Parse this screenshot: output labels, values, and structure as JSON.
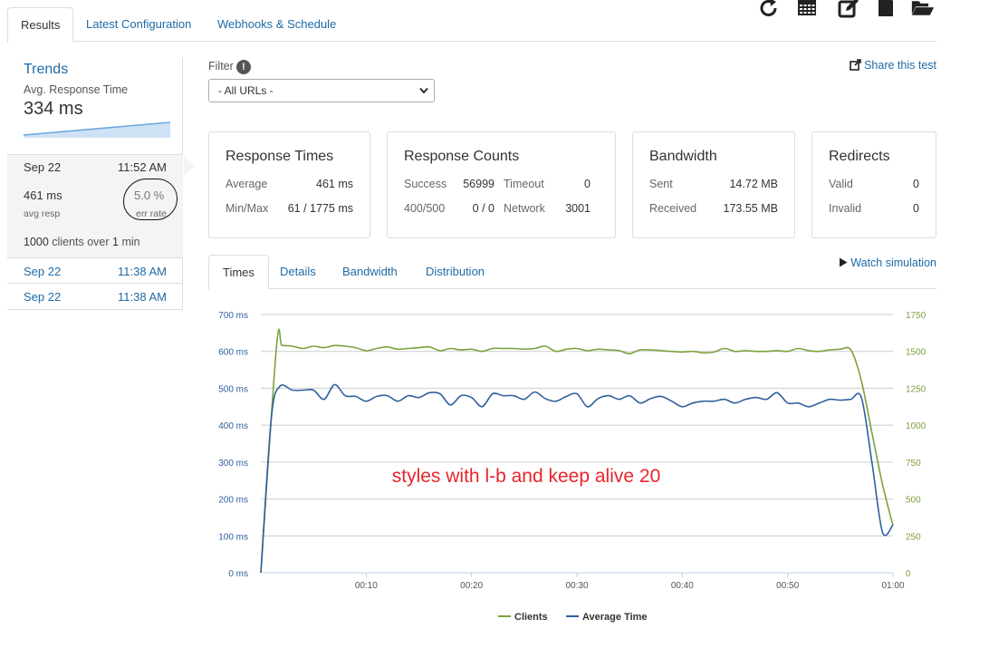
{
  "tabs": [
    {
      "label": "Results",
      "active": true
    },
    {
      "label": "Latest Configuration",
      "active": false
    },
    {
      "label": "Webhooks & Schedule",
      "active": false
    }
  ],
  "toolbar_icons": [
    "refresh-icon",
    "calendar-icon",
    "edit-icon",
    "document-icon",
    "folder-open-icon"
  ],
  "trends": {
    "title": "Trends",
    "metric": "Avg. Response Time",
    "value": "334 ms"
  },
  "runs": {
    "selected": {
      "date": "Sep 22",
      "time": "11:52 AM",
      "avg_resp": "461 ms",
      "avg_resp_label": "avg resp",
      "err_rate": "5.0 %",
      "err_rate_label": "err rate",
      "clients_count": "1000",
      "clients_mid": "clients over",
      "clients_duration": "1",
      "clients_unit": "min"
    },
    "others": [
      {
        "date": "Sep 22",
        "time": "11:38 AM"
      },
      {
        "date": "Sep 22",
        "time": "11:38 AM"
      }
    ]
  },
  "filter": {
    "label": "Filter",
    "selected": "- All URLs -"
  },
  "share_label": "Share this test",
  "cards": {
    "response_times": {
      "title": "Response Times",
      "average_label": "Average",
      "average_value": "461 ms",
      "minmax_label": "Min/Max",
      "minmax_value": "61 / 1775 ms"
    },
    "response_counts": {
      "title": "Response Counts",
      "success_label": "Success",
      "success_value": "56999",
      "timeout_label": "Timeout",
      "timeout_value": "0",
      "http_label": "400/500",
      "http_value": "0 / 0",
      "network_label": "Network",
      "network_value": "3001"
    },
    "bandwidth": {
      "title": "Bandwidth",
      "sent_label": "Sent",
      "sent_value": "14.72 MB",
      "received_label": "Received",
      "received_value": "173.55 MB"
    },
    "redirects": {
      "title": "Redirects",
      "valid_label": "Valid",
      "valid_value": "0",
      "invalid_label": "Invalid",
      "invalid_value": "0"
    }
  },
  "chart_tabs": [
    {
      "label": "Times",
      "active": true
    },
    {
      "label": "Details",
      "active": false
    },
    {
      "label": "Bandwidth",
      "active": false
    },
    {
      "label": "Distribution",
      "active": false
    }
  ],
  "watch_label": "Watch simulation",
  "colors": {
    "link": "#1f6aa5",
    "clients": "#7da13d",
    "avg_time": "#2f5f9e",
    "annotation": "#e8252b",
    "grid": "#cccccc"
  },
  "chart_data": {
    "type": "line",
    "annotation": "styles with l-b and keep alive 20",
    "x_ticks": [
      "00:10",
      "00:20",
      "00:30",
      "00:40",
      "00:50",
      "01:00"
    ],
    "xlim": [
      0,
      60
    ],
    "y_left": {
      "ticks": [
        "0 ms",
        "100 ms",
        "200 ms",
        "300 ms",
        "400 ms",
        "500 ms",
        "600 ms",
        "700 ms"
      ],
      "ylim": [
        0,
        700
      ],
      "unit": "ms"
    },
    "y_right": {
      "ticks": [
        "0",
        "250",
        "500",
        "750",
        "1000",
        "1250",
        "1500",
        "1750"
      ],
      "ylim": [
        0,
        1750
      ]
    },
    "grid": true,
    "legend_position": "bottom",
    "series": [
      {
        "name": "Clients",
        "axis": "right",
        "x": [
          0,
          1.5,
          2,
          3,
          4,
          5,
          6,
          7,
          8,
          9,
          10,
          11,
          12,
          13,
          14,
          15,
          16,
          17,
          18,
          19,
          20,
          21,
          22,
          23,
          24,
          25,
          26,
          27,
          28,
          29,
          30,
          31,
          32,
          33,
          34,
          35,
          36,
          37,
          38,
          39,
          40,
          41,
          42,
          43,
          44,
          45,
          46,
          47,
          48,
          49,
          50,
          51,
          52,
          53,
          54,
          55,
          56,
          57,
          58,
          59,
          60
        ],
        "y": [
          0,
          1540,
          1540,
          1535,
          1520,
          1535,
          1525,
          1540,
          1535,
          1525,
          1505,
          1520,
          1530,
          1515,
          1520,
          1525,
          1530,
          1505,
          1520,
          1510,
          1515,
          1500,
          1520,
          1520,
          1520,
          1515,
          1520,
          1535,
          1500,
          1515,
          1520,
          1505,
          1515,
          1510,
          1505,
          1485,
          1510,
          1510,
          1505,
          1500,
          1495,
          1500,
          1490,
          1495,
          1520,
          1500,
          1505,
          1500,
          1500,
          1505,
          1500,
          1520,
          1505,
          1500,
          1510,
          1515,
          1510,
          1300,
          950,
          600,
          320
        ]
      },
      {
        "name": "Average Time",
        "axis": "left",
        "x": [
          0,
          1,
          1.8,
          3,
          4,
          5,
          6,
          7,
          8,
          9,
          10,
          11,
          12,
          13,
          14,
          15,
          16,
          17,
          18,
          19,
          20,
          21,
          22,
          23,
          24,
          25,
          26,
          27,
          28,
          29,
          30,
          31,
          32,
          33,
          34,
          35,
          36,
          37,
          38,
          39,
          40,
          41,
          42,
          43,
          44,
          45,
          46,
          47,
          48,
          49,
          50,
          51,
          52,
          53,
          54,
          55,
          56,
          57,
          58,
          59,
          60
        ],
        "y": [
          0,
          420,
          505,
          495,
          495,
          495,
          470,
          510,
          480,
          478,
          465,
          478,
          480,
          465,
          480,
          475,
          488,
          485,
          455,
          480,
          475,
          450,
          485,
          480,
          480,
          470,
          490,
          472,
          465,
          478,
          485,
          450,
          472,
          480,
          470,
          480,
          460,
          472,
          478,
          465,
          450,
          460,
          465,
          465,
          470,
          460,
          470,
          475,
          470,
          488,
          460,
          460,
          450,
          460,
          470,
          468,
          470,
          475,
          300,
          110,
          130
        ]
      }
    ]
  }
}
